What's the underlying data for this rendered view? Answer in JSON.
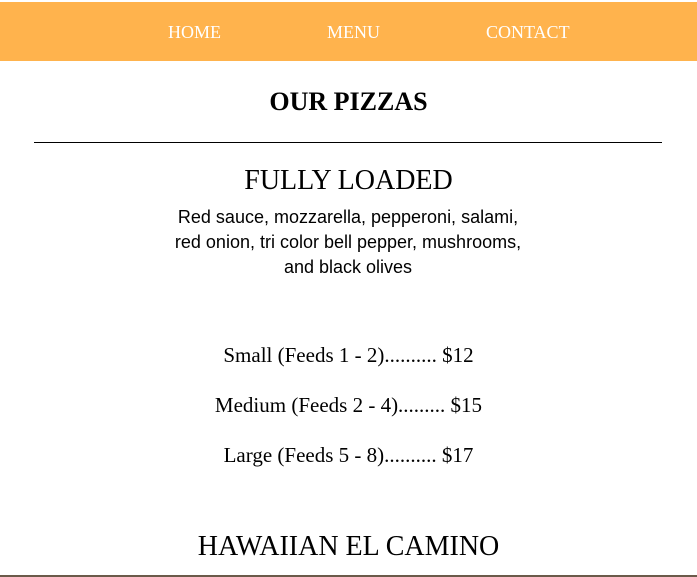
{
  "nav": {
    "items": [
      {
        "label": "HOME"
      },
      {
        "label": "MENU"
      },
      {
        "label": "CONTACT"
      }
    ]
  },
  "page": {
    "title": "OUR PIZZAS"
  },
  "pizzas": [
    {
      "name": "FULLY LOADED",
      "description_lines": [
        "Red sauce, mozzarella, pepperoni, salami,",
        "red onion, tri color bell pepper, mushrooms,",
        "and black olives"
      ],
      "prices": [
        "Small (Feeds 1 - 2).......... $12",
        "Medium (Feeds 2 - 4)......... $15",
        "Large (Feeds 5 - 8).......... $17"
      ]
    },
    {
      "name": "HAWAIIAN EL CAMINO"
    }
  ],
  "colors": {
    "nav_background": "#ffb34d",
    "nav_text": "#ffffff"
  }
}
